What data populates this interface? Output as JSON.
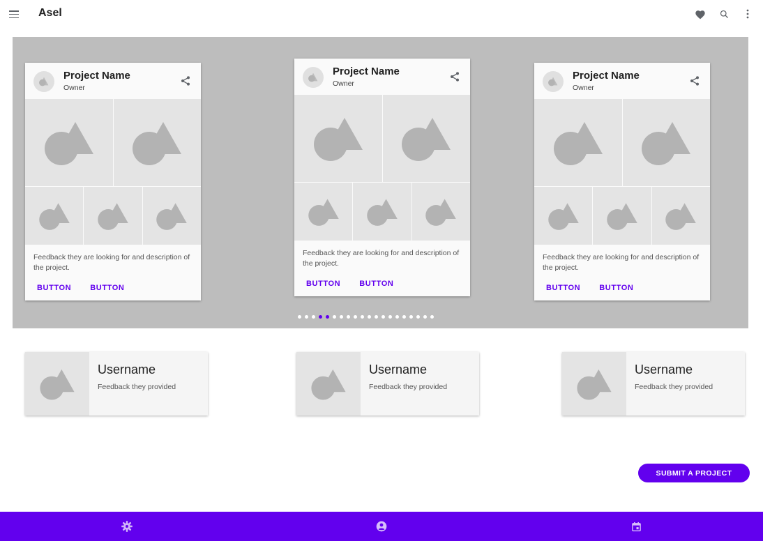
{
  "app": {
    "title": "Asel"
  },
  "topbar": {
    "icons": [
      "menu-icon",
      "heart-icon",
      "search-icon",
      "more-vert-icon"
    ]
  },
  "carousel": {
    "cards": [
      {
        "name": "Project Name",
        "owner": "Owner",
        "description": "Feedback they are looking for and description of the project.",
        "button1": "BUTTON",
        "button2": "BUTTON"
      },
      {
        "name": "Project Name",
        "owner": "Owner",
        "description": "Feedback they are looking for and description of the project.",
        "button1": "BUTTON",
        "button2": "BUTTON"
      },
      {
        "name": "Project Name",
        "owner": "Owner",
        "description": "Feedback they are looking for and description of the project.",
        "button1": "BUTTON",
        "button2": "BUTTON"
      }
    ],
    "dots": {
      "count": 20,
      "active": [
        3,
        4
      ]
    }
  },
  "feedback": [
    {
      "username": "Username",
      "text": "Feedback they provided"
    },
    {
      "username": "Username",
      "text": "Feedback they provided"
    },
    {
      "username": "Username",
      "text": "Feedback they provided"
    }
  ],
  "submit": {
    "label": "SUBMIT A PROJECT"
  },
  "bottom_nav": {
    "items": [
      "settings-icon",
      "account-icon",
      "calendar-icon"
    ]
  },
  "colors": {
    "accent": "#6200ee",
    "carousel_bg": "#bdbdbd",
    "placeholder": "#e4e4e4",
    "placeholder_shape": "#b3b3b3"
  }
}
